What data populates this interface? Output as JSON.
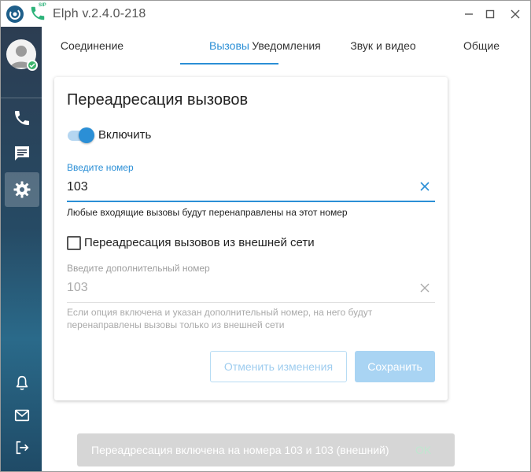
{
  "window": {
    "title": "Elph v.2.4.0-218",
    "sip_badge": "SIP"
  },
  "tabs": [
    {
      "label": "Соединение"
    },
    {
      "label": "Вызовы",
      "active": true
    },
    {
      "label": "Уведомления"
    },
    {
      "label": "Звук и видео"
    },
    {
      "label": "Общие"
    }
  ],
  "sidebar": {
    "items": [
      {
        "icon": "phone-icon"
      },
      {
        "icon": "chat-icon"
      },
      {
        "icon": "gear-icon",
        "active": true
      },
      {
        "icon": "bell-icon"
      },
      {
        "icon": "mail-icon"
      },
      {
        "icon": "logout-icon"
      }
    ]
  },
  "card": {
    "title": "Переадресация вызовов",
    "toggle_label": "Включить",
    "toggle_on": true,
    "number_label": "Введите номер",
    "number_value": "103",
    "number_helper": "Любые входящие вызовы будут перенаправлены на этот номер",
    "external_label": "Переадресация вызовов из внешней сети",
    "external_checked": false,
    "extra_label": "Введите дополнительный номер",
    "extra_value": "103",
    "extra_helper_1": "Если опция включена и указан дополнительный номер, на него будут",
    "extra_helper_2": "перенаправлены вызовы только из внешней сети",
    "cancel_label": "Отменить изменения",
    "save_label": "Сохранить"
  },
  "snackbar": {
    "text": "Переадресация включена на номера 103 и 103 (внешний)",
    "action": "OK"
  },
  "colors": {
    "accent": "#2b8fd6",
    "status_online": "#3bb36b"
  }
}
